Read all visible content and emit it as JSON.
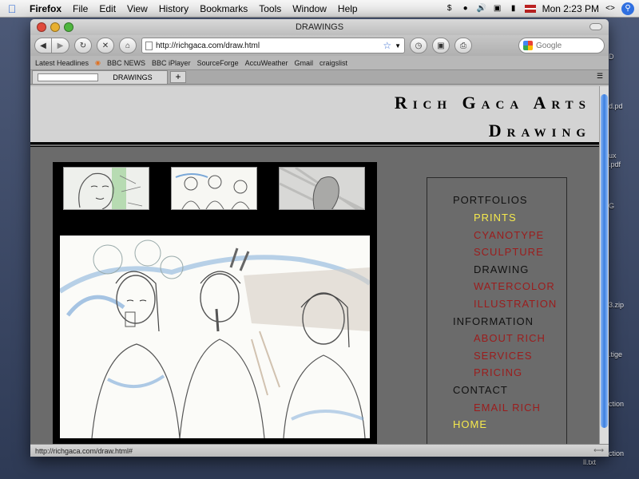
{
  "menubar": {
    "app": "Firefox",
    "items": [
      "File",
      "Edit",
      "View",
      "History",
      "Bookmarks",
      "Tools",
      "Window",
      "Help"
    ],
    "clock": "Mon 2:23 PM"
  },
  "desktop_labels": [
    "D",
    "d.pd",
    "ux",
    ".pdf",
    "G",
    "3.zip",
    ".tige",
    "ction",
    "Jan",
    "ction",
    "ll.txt"
  ],
  "window": {
    "title": "DRAWINGS",
    "url": "http://richgaca.com/draw.html",
    "search_placeholder": "Google",
    "bookmarks": [
      "Latest Headlines",
      "BBC NEWS",
      "BBC iPlayer",
      "SourceForge",
      "AccuWeather",
      "Gmail",
      "craigslist"
    ],
    "tab_label": "DRAWINGS",
    "status_text": "http://richgaca.com/draw.html#"
  },
  "site": {
    "title": "Rich Gaca Arts",
    "subtitle": "Drawing",
    "nav": {
      "portfolios": "PORTFOLIOS",
      "prints": "PRINTS",
      "cyanotype": "CYANOTYPE",
      "sculpture": "SCULPTURE",
      "drawing": "DRAWING",
      "watercolor": "WATERCOLOR",
      "illustration": "ILLUSTRATION",
      "information": "INFORMATION",
      "about": "ABOUT RICH",
      "services": "SERVICES",
      "pricing": "PRICING",
      "contact": "CONTACT",
      "email": "EMAIL RICH",
      "home": "HOME"
    }
  },
  "colors": {
    "nav_link": "#9b1c1c",
    "nav_highlight": "#f5e94d",
    "page_bg": "#6b6b6b",
    "header_bg": "#d3d3d3"
  }
}
